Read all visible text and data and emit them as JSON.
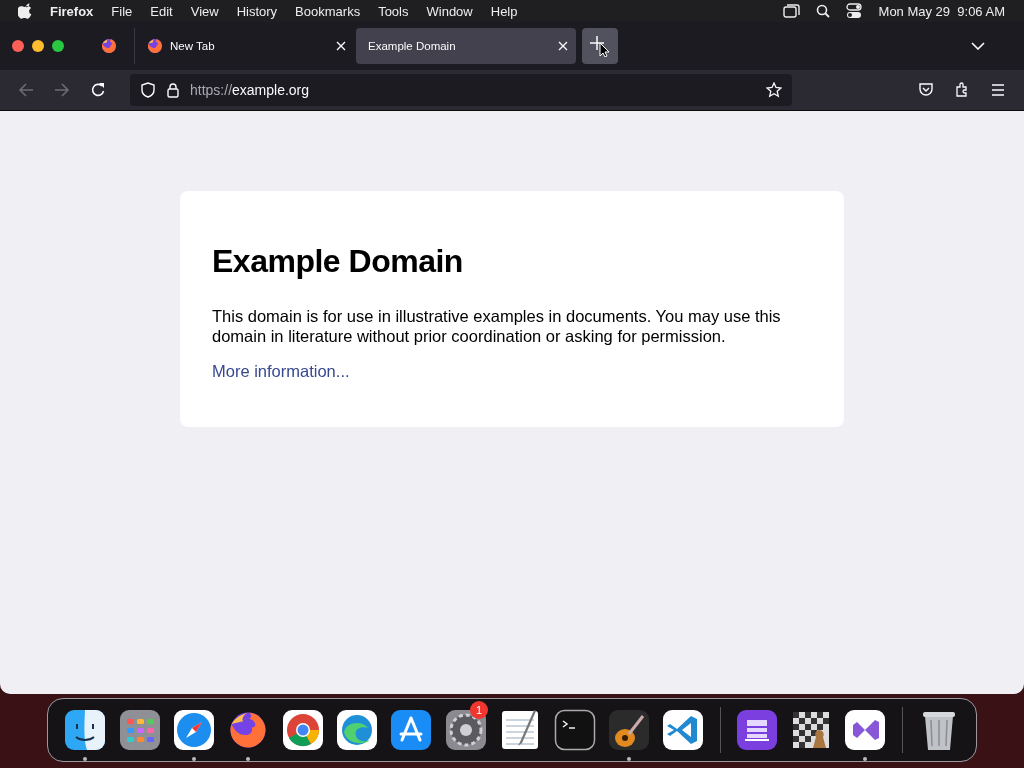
{
  "menu_bar": {
    "app_name": "Firefox",
    "menus": [
      "File",
      "Edit",
      "View",
      "History",
      "Bookmarks",
      "Tools",
      "Window",
      "Help"
    ],
    "clock": "Mon May 29  9:06 AM"
  },
  "tabs": [
    {
      "kind": "pinned",
      "selected": false
    },
    {
      "kind": "normal",
      "label": "New Tab",
      "selected": false
    },
    {
      "kind": "normal",
      "label": "Example Domain",
      "selected": true
    }
  ],
  "address_bar": {
    "scheme": "https://",
    "host": "example.org"
  },
  "page": {
    "heading": "Example Domain",
    "paragraph": "This domain is for use in illustrative examples in documents. You may use this domain in literature without prior coordination or asking for permission.",
    "link": "More information..."
  },
  "dock": {
    "apps": [
      {
        "running": true
      },
      {
        "running": false
      },
      {
        "running": true
      },
      {
        "running": true
      },
      {
        "running": false
      },
      {
        "running": false
      },
      {
        "running": false
      },
      {
        "running": false,
        "badge": "1"
      },
      {
        "running": false
      },
      {
        "running": false
      },
      {
        "running": true
      },
      {
        "running": false
      }
    ],
    "extra": [
      {
        "running": false
      },
      {
        "running": false
      },
      {
        "running": true
      }
    ],
    "trash": {
      "running": false
    }
  }
}
